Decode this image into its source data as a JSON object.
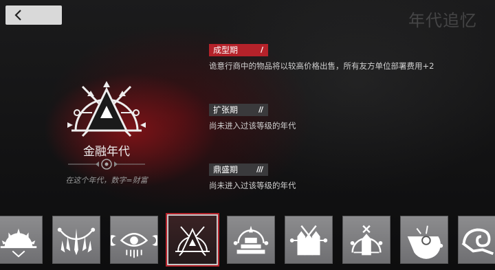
{
  "header": {
    "title": "年代追忆"
  },
  "era": {
    "name": "金融年代",
    "description": "在这个年代，数字=财富"
  },
  "stages": [
    {
      "label": "成型期",
      "text": "诡意行商中的物品将以较高价格出售，所有友方单位部署费用+2",
      "active": true,
      "marks": "/"
    },
    {
      "label": "扩张期",
      "text": "尚未进入过该等级的年代",
      "active": false,
      "marks": "//"
    },
    {
      "label": "鼎盛期",
      "text": "尚未进入过该等级的年代",
      "active": false,
      "marks": "///"
    }
  ],
  "era_cards": [
    {
      "icon": "sunrise-crown-era-icon"
    },
    {
      "icon": "spiked-crown-era-icon"
    },
    {
      "icon": "eye-moons-era-icon"
    },
    {
      "icon": "finance-triangle-era-icon",
      "selected": true
    },
    {
      "icon": "stepped-temple-era-icon"
    },
    {
      "icon": "twin-tower-era-icon"
    },
    {
      "icon": "arched-tower-era-icon"
    },
    {
      "icon": "broken-machine-era-icon"
    },
    {
      "icon": "spiral-horn-era-icon"
    }
  ]
}
